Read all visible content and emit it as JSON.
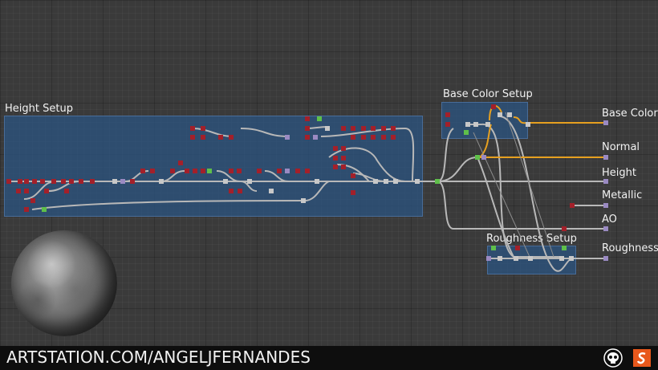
{
  "frames": {
    "height_setup": "Height Setup",
    "base_color_setup": "Base Color Setup",
    "roughness_setup": "Roughness Setup"
  },
  "outputs": {
    "base_color": "Base Color",
    "normal": "Normal",
    "height": "Height",
    "metallic": "Metallic",
    "ao": "AO",
    "roughness": "Roughness"
  },
  "footer": {
    "site": "ARTSTATION.COM/ANGELJFERNANDES"
  },
  "colors": {
    "frame_fill": "#2b5482",
    "node_red": "#a3202a",
    "node_grey": "#c8c8c8",
    "node_green": "#5fbf4a",
    "node_purple": "#9a8ac2",
    "wire": "#b8b8b8",
    "wire_orange": "#e6a020",
    "logo_orange": "#e8581c"
  },
  "icons": [
    "material-sphere-preview",
    "skull-logo-icon",
    "substance-designer-logo-icon"
  ]
}
